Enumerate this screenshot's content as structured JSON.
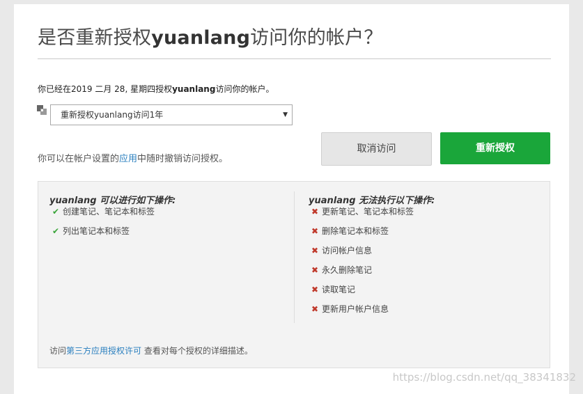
{
  "title": {
    "prefix": "是否重新授权",
    "app": "yuanlang",
    "suffix": "访问你的帐户？"
  },
  "since": {
    "prefix": "你已经在2019 二月 28, 星期四授权",
    "app": "yuanlang",
    "suffix": "访问你的帐户。"
  },
  "dropdown": {
    "icon": "app-icon",
    "value": "重新授权yuanlang访问1年",
    "caret": "▼"
  },
  "revoke_note": {
    "prefix": "你可以在帐户设置的",
    "link": "应用",
    "suffix": "中随时撤销访问授权。"
  },
  "buttons": {
    "cancel": "取消访问",
    "reauthorize": "重新授权"
  },
  "permissions": {
    "allowed_title_app": "yuanlang",
    "allowed_title": " 可以进行如下操作:",
    "allowed": [
      "创建笔记、笔记本和标签",
      "列出笔记本和标签"
    ],
    "denied_title_app": "yuanlang",
    "denied_title": " 无法执行以下操作:",
    "denied": [
      "更新笔记、笔记本和标签",
      "删除笔记本和标签",
      "访问帐户信息",
      "永久删除笔记",
      "读取笔记",
      "更新用户帐户信息"
    ],
    "allowed_mark": "✔",
    "denied_mark": "✖",
    "footer_prefix": "访问",
    "footer_link": "第三方应用授权许可",
    "footer_suffix": " 查看对每个授权的详细描述。"
  },
  "watermark": "https://blog.csdn.net/qq_38341832",
  "colors": {
    "accent_green": "#1aa63a",
    "link_blue": "#2a7fbf",
    "ok": "#3aa53a",
    "deny": "#c0392b"
  }
}
